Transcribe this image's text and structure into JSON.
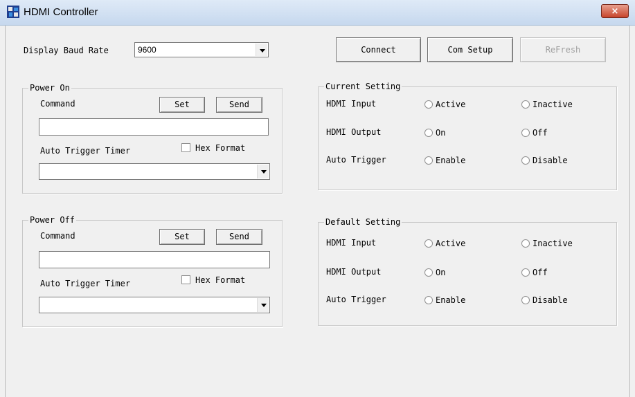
{
  "window": {
    "title": "HDMI Controller",
    "close_label": "×"
  },
  "baud": {
    "label": "Display Baud Rate",
    "value": "9600"
  },
  "toolbar": {
    "connect": "Connect",
    "com_setup": "Com Setup",
    "refresh": "ReFresh"
  },
  "power_on": {
    "title": "Power On",
    "command_label": "Command",
    "set": "Set",
    "send": "Send",
    "command_value": "",
    "timer_label": "Auto Trigger Timer",
    "hex_label": "Hex Format",
    "hex_checked": false,
    "timer_value": ""
  },
  "power_off": {
    "title": "Power Off",
    "command_label": "Command",
    "set": "Set",
    "send": "Send",
    "command_value": "",
    "timer_label": "Auto Trigger Timer",
    "hex_label": "Hex Format",
    "hex_checked": false,
    "timer_value": ""
  },
  "current": {
    "title": "Current Setting",
    "rows": [
      {
        "label": "HDMI Input",
        "opt1": "Active",
        "opt2": "Inactive"
      },
      {
        "label": "HDMI Output",
        "opt1": "On",
        "opt2": "Off"
      },
      {
        "label": "Auto Trigger",
        "opt1": "Enable",
        "opt2": "Disable"
      }
    ]
  },
  "default": {
    "title": "Default Setting",
    "rows": [
      {
        "label": "HDMI Input",
        "opt1": "Active",
        "opt2": "Inactive"
      },
      {
        "label": "HDMI Output",
        "opt1": "On",
        "opt2": "Off"
      },
      {
        "label": "Auto Trigger",
        "opt1": "Enable",
        "opt2": "Disable"
      }
    ]
  }
}
